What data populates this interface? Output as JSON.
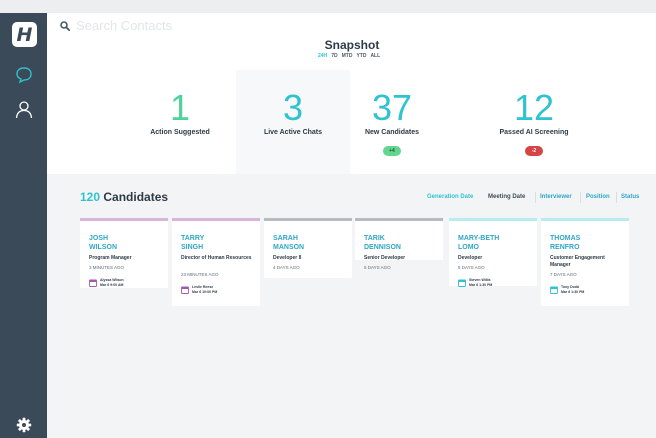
{
  "brand": {
    "logo_letter": "H",
    "accent_color": "#2fc3cf"
  },
  "search": {
    "placeholder": "Search Contacts",
    "value": ""
  },
  "snapshot": {
    "title": "Snapshot",
    "ranges": [
      "24H",
      "7D",
      "MTD",
      "YTD",
      "ALL"
    ],
    "active_range": "24H",
    "stats": [
      {
        "value": "1",
        "label": "Action Suggested",
        "color": "#4cd39a",
        "badge": null
      },
      {
        "value": "3",
        "label": "Live Active Chats",
        "color": "#2fc3cf",
        "badge": null
      },
      {
        "value": "37",
        "label": "New Candidates",
        "color": "#2fc3cf",
        "badge": "+4",
        "badge_color": "#62d68f"
      },
      {
        "value": "12",
        "label": "Passed AI Screening",
        "color": "#2fc3cf",
        "badge": "-2",
        "badge_color": "#d64545"
      }
    ]
  },
  "candidates": {
    "count": "120",
    "label": "Candidates",
    "filters": [
      {
        "label": "Generation Date",
        "active": true
      },
      {
        "label": "Meeting Date",
        "active": false
      },
      {
        "label": "Interviewer",
        "active": false
      },
      {
        "label": "Position",
        "active": false
      },
      {
        "label": "Status",
        "active": false
      }
    ],
    "cards": [
      {
        "name": "JOSH\nWILSON",
        "title": "Program Manager",
        "time": "3 MINUTES AGO",
        "border": "#d8b6dc",
        "icon_color": "#a45aa8",
        "meeting": {
          "interviewer": "Alyssa Wilson",
          "when": "Mar 6 9:00 AM"
        }
      },
      {
        "name": "TARRY\nSINGH",
        "title": "Director of Human Resources",
        "time": "23 MINUTES AGO",
        "border": "#d8b6dc",
        "icon_color": "#a45aa8",
        "meeting": {
          "interviewer": "Leslie Reese",
          "when": "Mar 6 10:00 PM"
        }
      },
      {
        "name": "SARAH\nMANSON",
        "title": "Developer II",
        "time": "4 DAYS AGO",
        "border": "#b4bcc0",
        "icon_color": null,
        "meeting": null
      },
      {
        "name": "TARIK\nDENNISON",
        "title": "Senior Developer",
        "time": "5 DAYS AGO",
        "border": "#b4bcc0",
        "icon_color": null,
        "meeting": null
      },
      {
        "name": "MARY-BETH\nLOMO",
        "title": "Developer",
        "time": "5 DAYS AGO",
        "border": "#b8ecf0",
        "icon_color": "#2fc3cf",
        "meeting": {
          "interviewer": "Steven Willis",
          "when": "Mar 6 1:30 PM"
        }
      },
      {
        "name": "THOMAS\nRENFRO",
        "title": "Customer Engagement Manager",
        "time": "7 DAYS AGO",
        "border": "#b8ecf0",
        "icon_color": "#2fc3cf",
        "meeting": {
          "interviewer": "Tony Dodd",
          "when": "Mar 6 1:30 PM"
        }
      }
    ]
  }
}
